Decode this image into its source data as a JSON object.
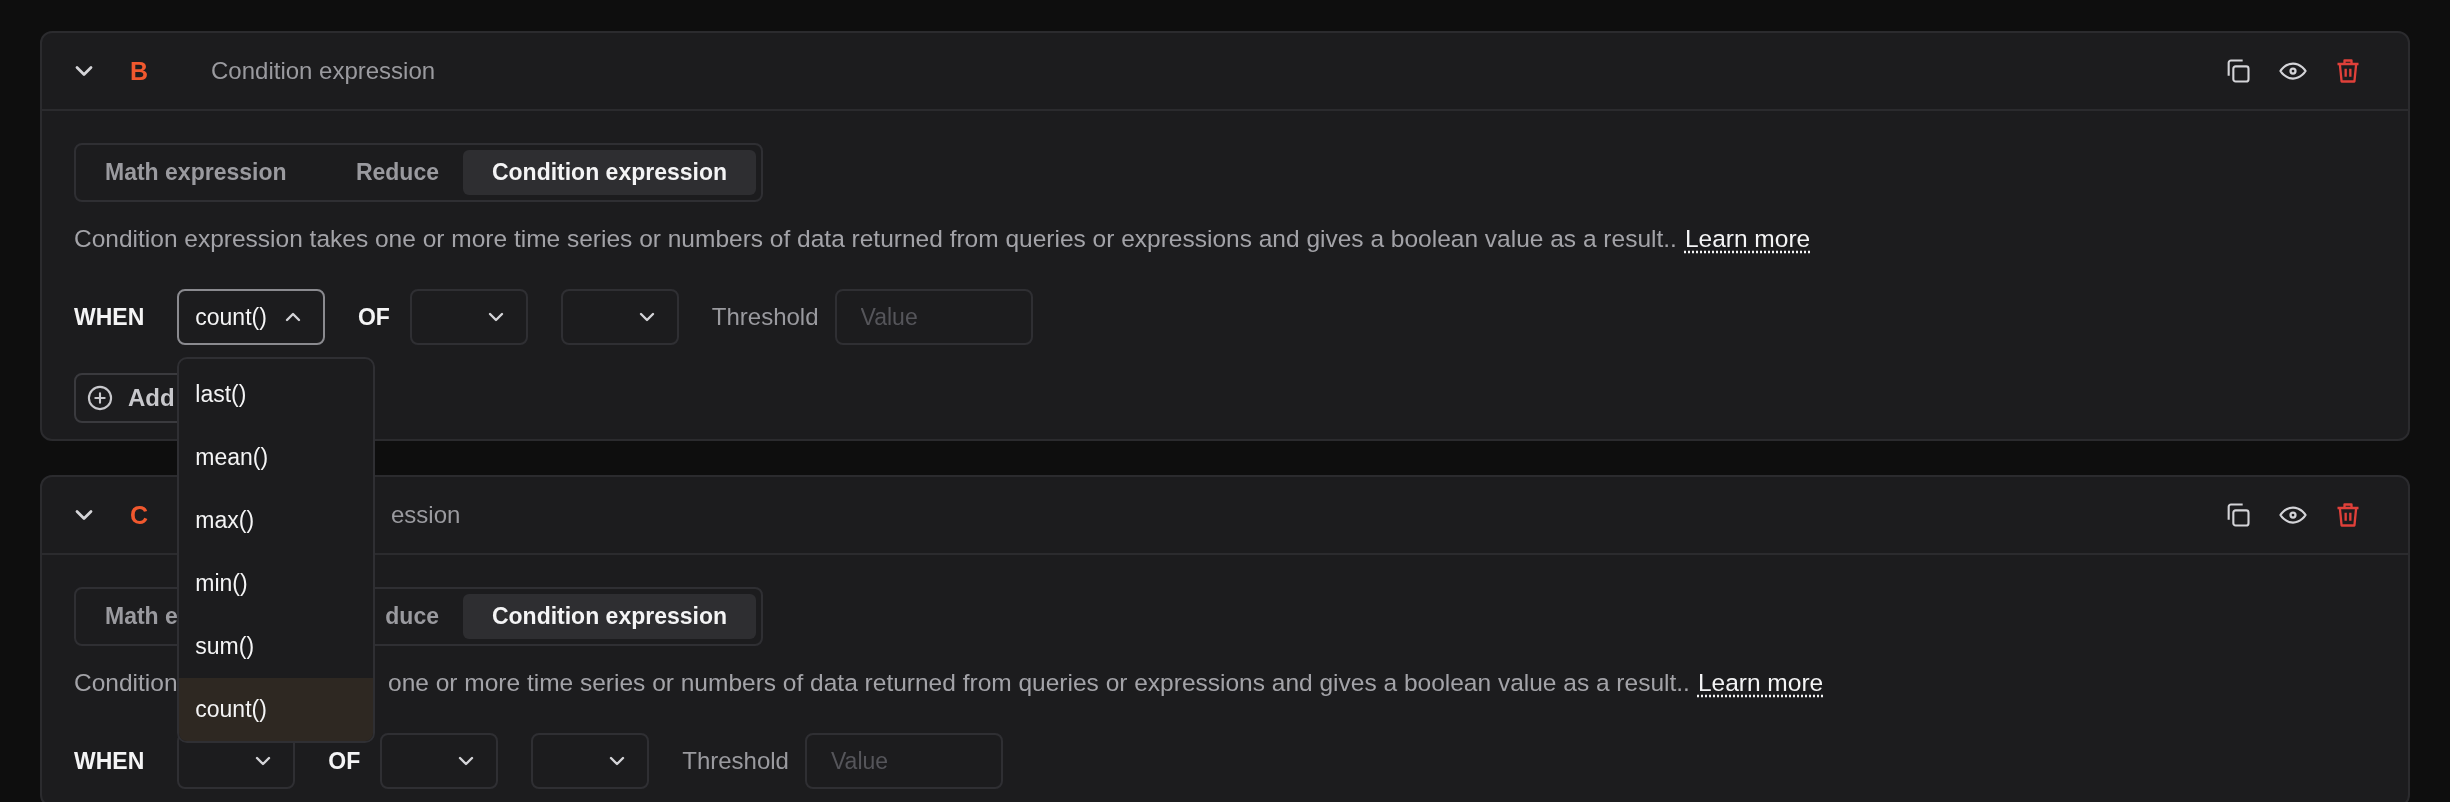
{
  "cards": [
    {
      "letter": "B",
      "title": "Condition expression",
      "expanded": true,
      "tabs": [
        {
          "label": "Math expression",
          "selected": false
        },
        {
          "label": "Reduce",
          "selected": false
        },
        {
          "label": "Condition expression",
          "selected": true
        }
      ],
      "description": [
        "Condition expression takes one or more time series or numbers of data returned from queries or expressions and gives a boolean value as a result.."
      ],
      "link": "Learn more",
      "when_label": "WHEN",
      "when_select": {
        "value": "count()",
        "expanded": true,
        "options": [
          {
            "label": "last()",
            "selected": false
          },
          {
            "label": "mean()",
            "selected": false
          },
          {
            "label": "max()",
            "selected": false
          },
          {
            "label": "min()",
            "selected": false
          },
          {
            "label": "sum()",
            "selected": false
          },
          {
            "label": "count()",
            "selected": true
          }
        ]
      },
      "of_label": "OF",
      "of_selects": [
        {
          "expanded": false
        },
        {
          "expanded": false
        }
      ],
      "threshold_label": "Threshold",
      "threshold_placeholder": "Value",
      "add_button": "Add"
    },
    {
      "letter": "C",
      "title": "ession",
      "expanded": true,
      "tabs": [
        {
          "label": "Math e",
          "selected": false
        },
        {
          "label": "duce",
          "selected": false
        },
        {
          "label": "Condition expression",
          "selected": true
        }
      ],
      "description": [
        "Condition",
        "one or more time series or numbers of data returned from queries or expressions and gives a boolean value as a result.."
      ],
      "link": "Learn more",
      "when_label": "WHEN",
      "when_select": {
        "expanded": false
      },
      "of_label": "OF",
      "of_selects": [
        {
          "expanded": false
        },
        {
          "expanded": false
        }
      ],
      "threshold_label": "Threshold",
      "threshold_placeholder": "Value"
    }
  ]
}
